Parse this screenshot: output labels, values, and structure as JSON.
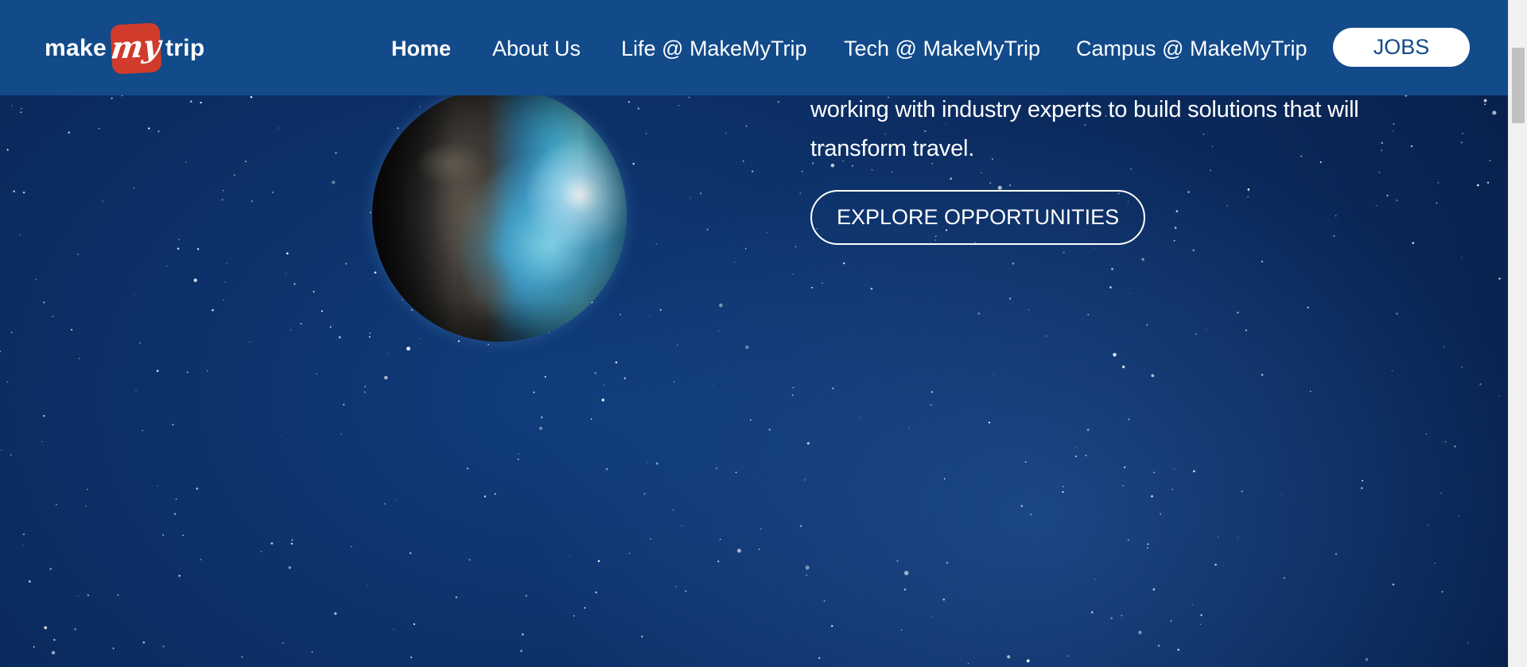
{
  "header": {
    "logo": {
      "left_word": "make",
      "badge_word": "my",
      "right_word": "trip"
    },
    "nav": [
      {
        "label": "Home",
        "active": true
      },
      {
        "label": "About Us",
        "active": false
      },
      {
        "label": "Life @ MakeMyTrip",
        "active": false
      },
      {
        "label": "Tech @ MakeMyTrip",
        "active": false
      },
      {
        "label": "Campus @ MakeMyTrip",
        "active": false
      }
    ],
    "jobs_label": "JOBS"
  },
  "hero": {
    "text_line1": "working with industry experts to build solutions that will",
    "text_line2": "transform travel.",
    "cta_label": "EXPLORE OPPORTUNITIES",
    "globe_icon": "earth-globe"
  },
  "colors": {
    "header_bg": "#124a8a",
    "hero_bg": "#0c2f66",
    "logo_badge": "#d03b2b",
    "text": "#ffffff"
  }
}
